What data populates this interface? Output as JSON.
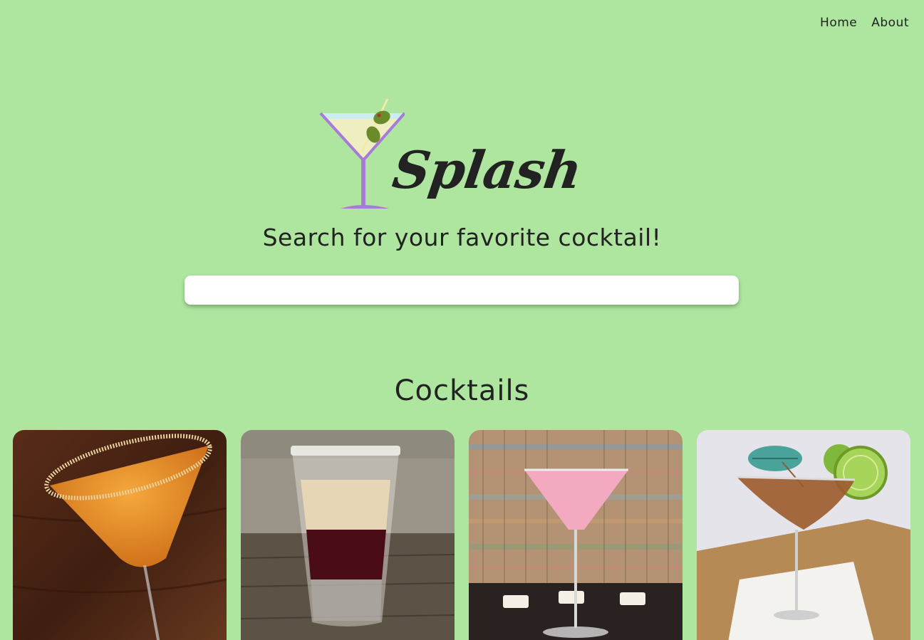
{
  "nav": {
    "items": [
      {
        "label": "Home"
      },
      {
        "label": "About"
      }
    ]
  },
  "brand": {
    "name": "Splash",
    "logo_icon": "martini-glass-icon",
    "glass_color": "#a97bd8",
    "olive_color": "#6b8a2a"
  },
  "hero": {
    "tagline": "Search for your favorite cocktail!"
  },
  "search": {
    "placeholder": "",
    "value": ""
  },
  "cocktails": {
    "title": "Cocktails",
    "cards": [
      {
        "image": "orange-martini-sugar-rim-photo"
      },
      {
        "image": "layered-shot-glass-photo"
      },
      {
        "image": "pink-martini-candles-photo"
      },
      {
        "image": "martini-lime-umbrella-photo"
      }
    ]
  },
  "colors": {
    "background": "#aee6a0",
    "text": "#222222",
    "search_bg": "#ffffff"
  }
}
